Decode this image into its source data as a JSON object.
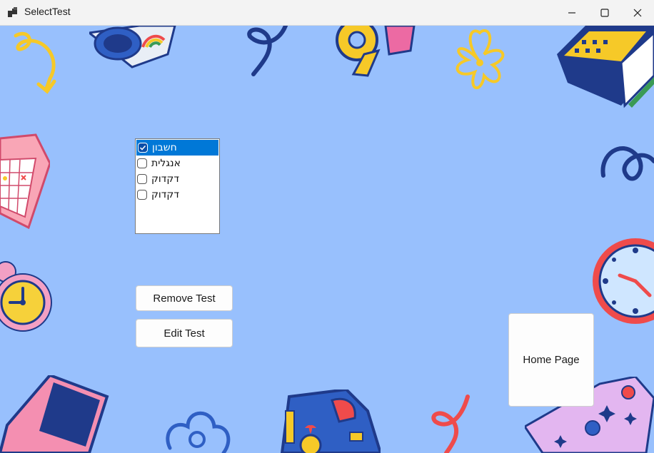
{
  "window": {
    "title": "SelectTest"
  },
  "titlebar": {
    "minimize_glyph": "—",
    "maximize_glyph": "☐",
    "close_glyph": "✕"
  },
  "list": {
    "items": [
      {
        "label": "חשבון",
        "checked": true,
        "selected": true
      },
      {
        "label": "אנגלית",
        "checked": false,
        "selected": false
      },
      {
        "label": "דקדוק",
        "checked": false,
        "selected": false
      },
      {
        "label": "דקדוק",
        "checked": false,
        "selected": false
      }
    ]
  },
  "buttons": {
    "remove": "Remove Test",
    "edit": "Edit Test",
    "home": "Home Page"
  },
  "colors": {
    "background": "#98c0fd",
    "selection": "#0078d7"
  },
  "decorations": [
    "yellow-squiggle-icon",
    "rainbow-jar-icon",
    "blue-squiggle-icon",
    "tape-icon",
    "flower-icon",
    "books-icon",
    "calendar-icon",
    "alarm-clock-icon",
    "wall-clock-icon",
    "laptop-icon",
    "cloud-icon",
    "backpack-icon",
    "red-squiggle-icon",
    "pencil-case-icon"
  ]
}
